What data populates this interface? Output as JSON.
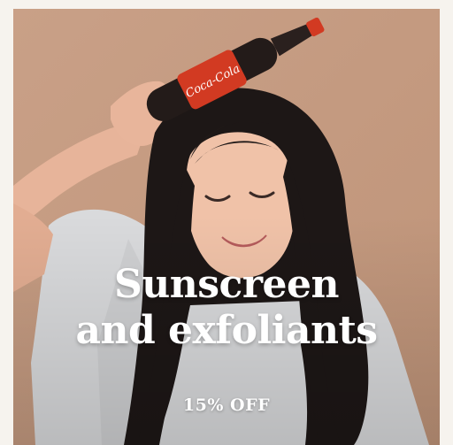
{
  "promo": {
    "headline_line1": "Sunscreen",
    "headline_line2": "and exfoliants",
    "offer": "15% OFF",
    "bottle_label": "Coca-Cola"
  },
  "colors": {
    "background": "#f6f3ee",
    "card_backdrop": "#c79c80",
    "text": "#ffffff",
    "bottle_label": "#d23a22",
    "shirt": "#d9dadc",
    "hair": "#1d1716"
  }
}
